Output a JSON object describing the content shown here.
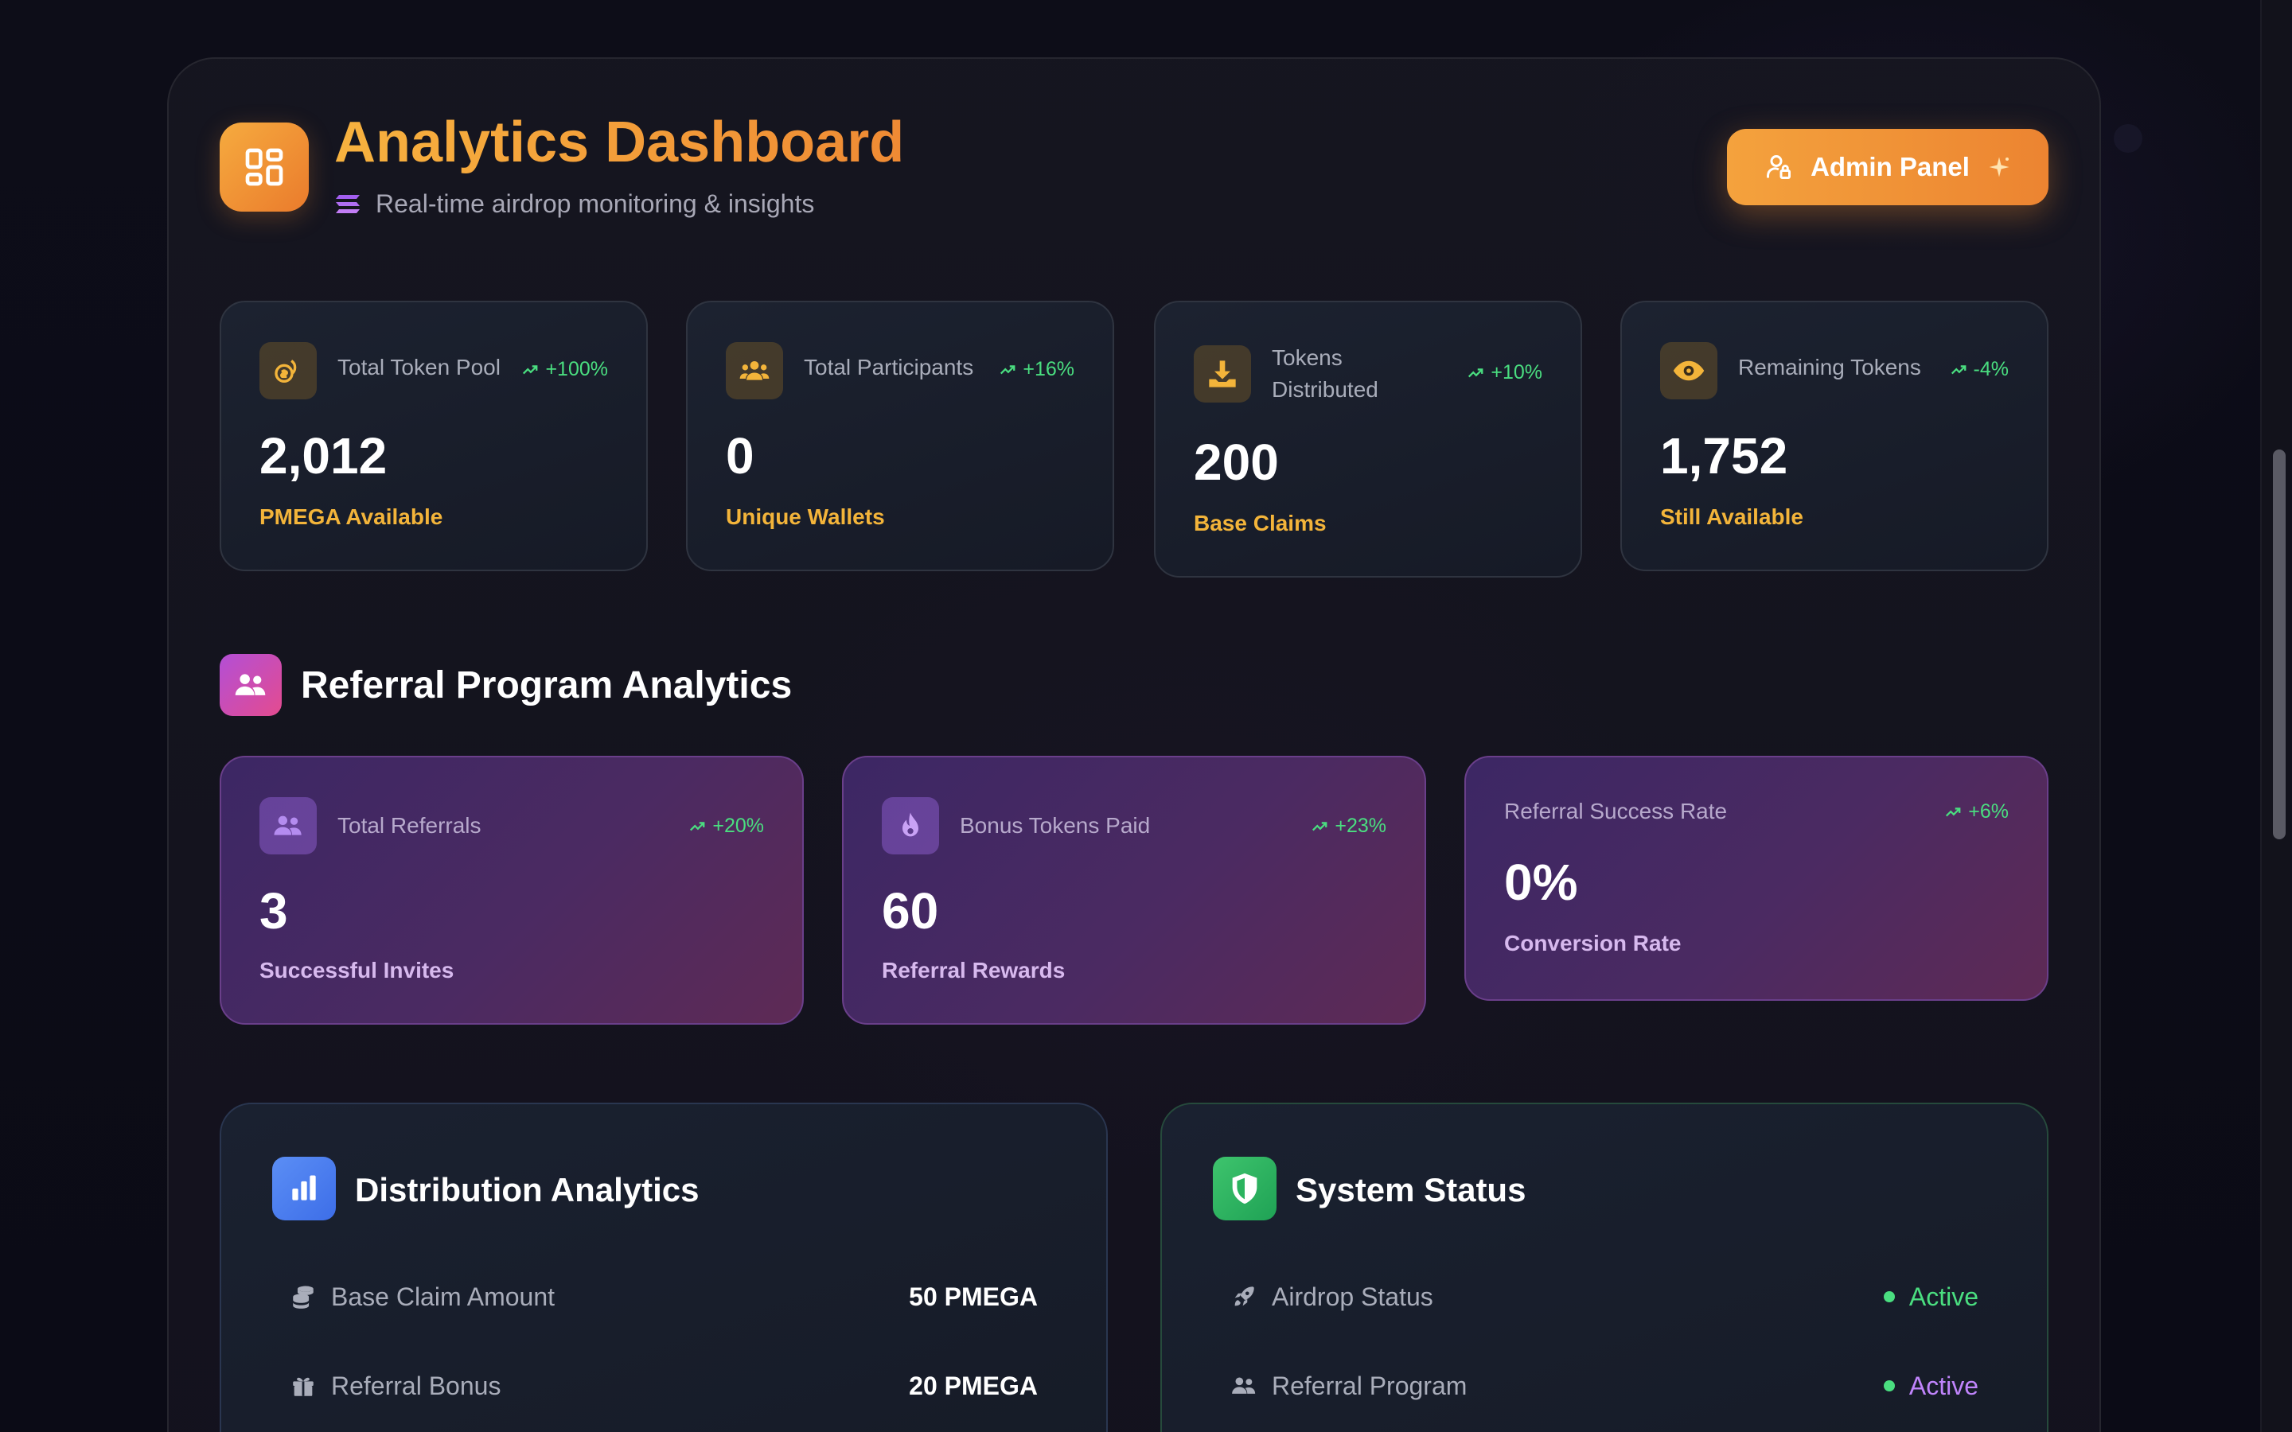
{
  "header": {
    "title": "Analytics Dashboard",
    "subtitle": "Real-time airdrop monitoring & insights",
    "admin_button": "Admin Panel"
  },
  "stats": [
    {
      "label": "Total Token Pool",
      "trend": "+100%",
      "value": "2,012",
      "sub": "PMEGA Available",
      "icon": "coins-icon"
    },
    {
      "label": "Total Participants",
      "trend": "+16%",
      "value": "0",
      "sub": "Unique Wallets",
      "icon": "users-icon"
    },
    {
      "label": "Tokens Distributed",
      "trend": "+10%",
      "value": "200",
      "sub": "Base Claims",
      "icon": "download-icon"
    },
    {
      "label": "Remaining Tokens",
      "trend": "-4%",
      "value": "1,752",
      "sub": "Still Available",
      "icon": "eye-icon"
    }
  ],
  "referral": {
    "section_title": "Referral Program Analytics",
    "cards": [
      {
        "label": "Total Referrals",
        "trend": "+20%",
        "value": "3",
        "sub": "Successful Invites",
        "icon": "users-icon"
      },
      {
        "label": "Bonus Tokens Paid",
        "trend": "+23%",
        "value": "60",
        "sub": "Referral Rewards",
        "icon": "flame-icon"
      },
      {
        "label": "Referral Success Rate",
        "trend": "+6%",
        "value": "0%",
        "sub": "Conversion Rate"
      }
    ]
  },
  "distribution": {
    "title": "Distribution Analytics",
    "rows": [
      {
        "label": "Base Claim Amount",
        "value": "50 PMEGA",
        "icon": "coins-stack-icon"
      },
      {
        "label": "Referral Bonus",
        "value": "20 PMEGA",
        "icon": "gift-icon"
      }
    ]
  },
  "system": {
    "title": "System Status",
    "rows": [
      {
        "label": "Airdrop Status",
        "value": "Active",
        "icon": "rocket-icon",
        "color": "#4ade80"
      },
      {
        "label": "Referral Program",
        "value": "Active",
        "icon": "users-icon",
        "color": "#c084fc"
      }
    ]
  },
  "colors": {
    "accent_orange": "#f4a23d",
    "trend_green": "#4ade80",
    "sub_gold": "#f3b43a",
    "referral_purple": "#4b2a62"
  }
}
